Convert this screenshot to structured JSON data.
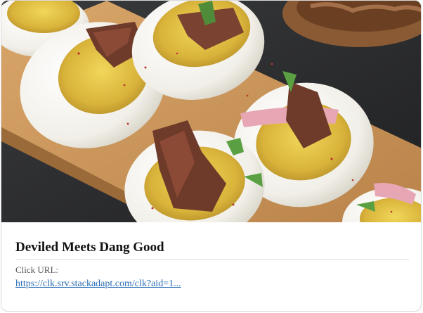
{
  "ad": {
    "image_alt": "Deviled eggs topped with shredded meat and pickled onion on a wooden board",
    "title": "Deviled Meets Dang Good",
    "click_url_label": "Click URL:",
    "click_url_text": "https://clk.srv.stackadapt.com/clk?aid=1...",
    "link_color": "#2a6db3"
  }
}
